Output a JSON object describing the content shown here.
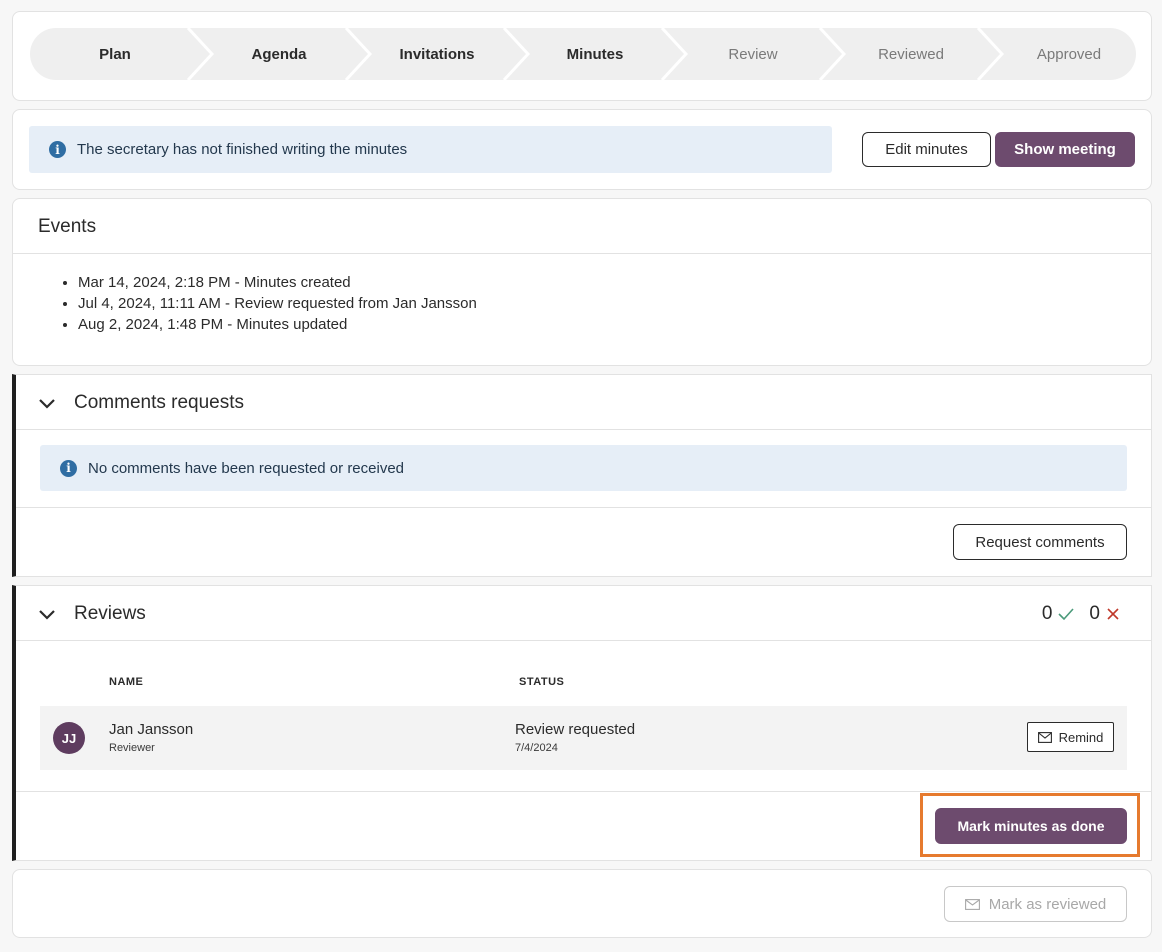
{
  "stepper": {
    "steps": [
      {
        "label": "Plan",
        "state": "done"
      },
      {
        "label": "Agenda",
        "state": "done"
      },
      {
        "label": "Invitations",
        "state": "done"
      },
      {
        "label": "Minutes",
        "state": "current"
      },
      {
        "label": "Review",
        "state": "pending"
      },
      {
        "label": "Reviewed",
        "state": "pending"
      },
      {
        "label": "Approved",
        "state": "pending"
      }
    ]
  },
  "status": {
    "info_text": "The secretary has not finished writing the minutes",
    "edit_minutes_label": "Edit minutes",
    "show_meeting_label": "Show meeting"
  },
  "events": {
    "title": "Events",
    "items": [
      "Mar 14, 2024, 2:18 PM - Minutes created",
      "Jul 4, 2024, 11:11 AM - Review requested from Jan Jansson",
      "Aug 2, 2024, 1:48 PM - Minutes updated"
    ]
  },
  "comments": {
    "title": "Comments requests",
    "info_text": "No comments have been requested or received",
    "request_button_label": "Request comments"
  },
  "reviews": {
    "title": "Reviews",
    "approved_count": "0",
    "rejected_count": "0",
    "col_name": "NAME",
    "col_status": "STATUS",
    "rows": [
      {
        "initials": "JJ",
        "name": "Jan Jansson",
        "role": "Reviewer",
        "status": "Review requested",
        "date": "7/4/2024",
        "remind_label": "Remind"
      }
    ],
    "mark_done_label": "Mark minutes as done"
  },
  "final": {
    "mark_reviewed_label": "Mark as reviewed"
  },
  "colors": {
    "primary": "#6d4b6e",
    "info_bg": "#e6eef7",
    "info_icon": "#2f6da3",
    "highlight": "#e67a2e",
    "approve": "#4a9a7a",
    "reject": "#c0392b"
  },
  "icons": {
    "info": "info-icon",
    "chevron": "chevron-down-icon",
    "check": "check-icon",
    "cross": "close-icon",
    "mail": "mail-icon"
  }
}
